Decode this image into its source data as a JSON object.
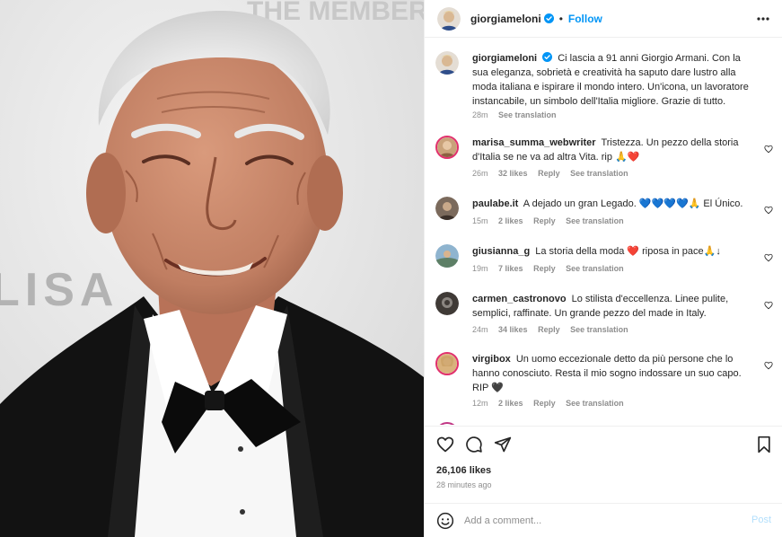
{
  "photo": {
    "backdrop_text_top": "THE MEMBERS",
    "backdrop_text_mid": "LISA"
  },
  "header": {
    "username": "giorgiameloni",
    "separator": "•",
    "follow_label": "Follow",
    "more_icon": "more-horizontal-icon"
  },
  "caption": {
    "username": "giorgiameloni",
    "text": "Ci lascia a 91 anni Giorgio Armani. Con la sua eleganza, sobrietà e creatività ha saputo dare lustro alla moda italiana e ispirare il mondo intero. Un'icona, un lavoratore instancabile, un simbolo dell'Italia migliore. Grazie di tutto.",
    "time": "28m",
    "see_translation": "See translation"
  },
  "comments": [
    {
      "username": "marisa_summa_webwriter",
      "text": "Tristezza. Un pezzo della storia d'Italia se ne va ad altra Vita. rip",
      "emoji": "🙏❤️",
      "time": "26m",
      "likes": "32 likes",
      "reply": "Reply",
      "see_translation": "See translation",
      "avatar_color": "#c9a27a"
    },
    {
      "username": "paulabe.it",
      "text": "A dejado un gran Legado.",
      "emoji": "💙💙💙💙🙏",
      "text_after": "El Único.",
      "time": "15m",
      "likes": "2 likes",
      "reply": "Reply",
      "see_translation": "See translation",
      "avatar_color": "#7b6a5c"
    },
    {
      "username": "giusianna_g",
      "text": "La storia della moda",
      "emoji": "❤️",
      "text_after": "riposa in pace",
      "emoji_after": "🙏↓",
      "time": "19m",
      "likes": "7 likes",
      "reply": "Reply",
      "see_translation": "See translation",
      "avatar_color": "#8fb4cf"
    },
    {
      "username": "carmen_castronovo",
      "text": "Lo stilista d'eccellenza. Linee pulite, semplici, raffinate. Un grande pezzo del made in Italy.",
      "time": "24m",
      "likes": "34 likes",
      "reply": "Reply",
      "see_translation": "See translation",
      "avatar_color": "#3f3a36"
    },
    {
      "username": "virgibox",
      "text": "Un uomo eccezionale detto da più persone che lo hanno conosciuto. Resta il mio sogno indossare un suo capo. RIP",
      "emoji": "🖤",
      "time": "12m",
      "likes": "2 likes",
      "reply": "Reply",
      "see_translation": "See translation",
      "avatar_color": "#d9b27c"
    }
  ],
  "actions": {
    "likes": "26,106 likes",
    "time_ago": "28 minutes ago",
    "comment_placeholder": "Add a comment...",
    "post_label": "Post"
  },
  "colors": {
    "follow_blue": "#0095f6",
    "muted_gray": "#8e8e8e",
    "text": "#262626",
    "post_disabled": "#b2dffc",
    "border": "#efefef"
  }
}
